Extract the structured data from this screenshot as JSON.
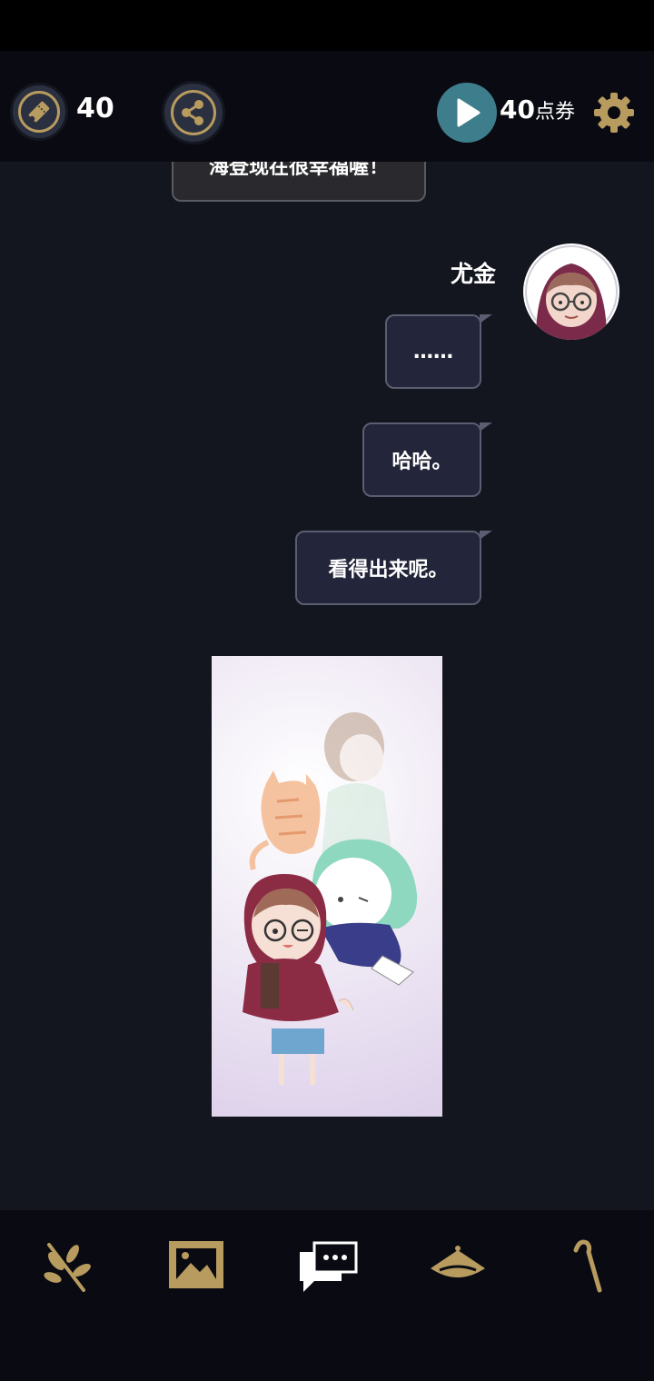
{
  "top_bar": {
    "ticket_count": "40",
    "points_value": "40",
    "points_unit": "点券",
    "icons": {
      "ticket": "ticket-icon",
      "share": "share-icon",
      "play": "play-icon",
      "settings": "gear-icon"
    }
  },
  "chat": {
    "previous_message": "海登现在很幸福喔！",
    "speaker": "尤金",
    "messages": [
      "……",
      "哈哈。",
      "看得出来呢。"
    ]
  },
  "bottom_nav": {
    "items": [
      "branch-icon",
      "gallery-icon",
      "chat-icon",
      "hat-icon",
      "cane-icon"
    ]
  },
  "colors": {
    "background": "#13151f",
    "bar": "#0a0b12",
    "gold": "#b79b5f",
    "bubble": "#23263a",
    "play": "#3e7d8c"
  }
}
